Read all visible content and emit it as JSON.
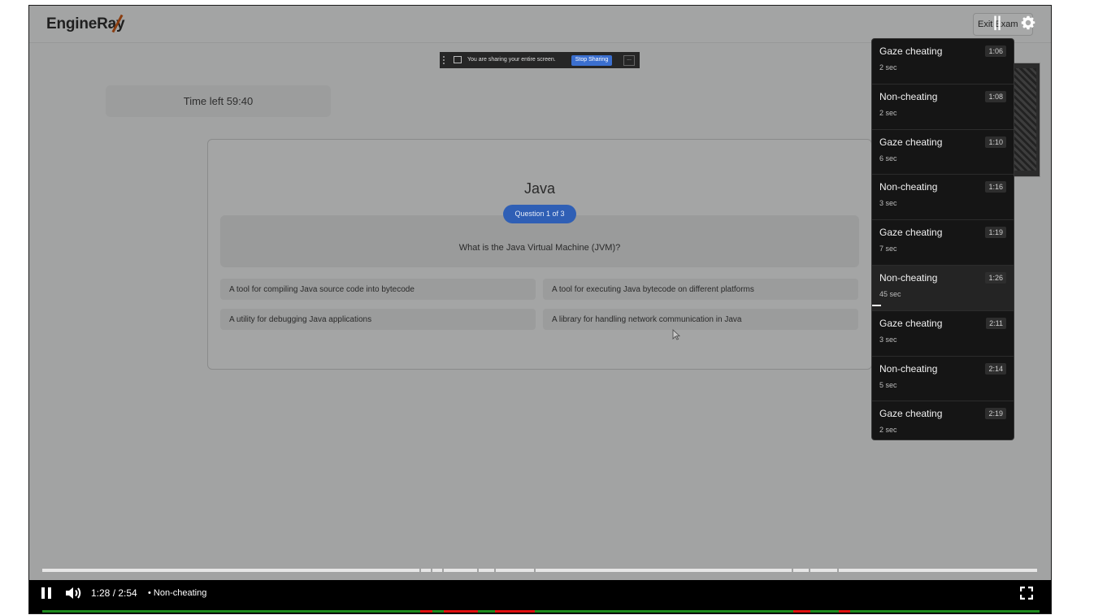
{
  "app": {
    "logo": "EngineRay",
    "exit_button": "Exit Exam",
    "timer": "Time left 59:40"
  },
  "share_bar": {
    "message": "You are sharing your entire screen.",
    "stop_button": "Stop Sharing",
    "more": "..."
  },
  "quiz": {
    "title": "Java",
    "badge": "Question 1 of 3",
    "question": "What is the Java Virtual Machine (JVM)?",
    "options": [
      "A tool for compiling Java source code into bytecode",
      "A tool for executing Java bytecode on different platforms",
      "A utility for debugging Java applications",
      "A library for handling network communication in Java"
    ]
  },
  "chapters": [
    {
      "title": "Gaze cheating",
      "time": "1:06",
      "duration": "2 sec"
    },
    {
      "title": "Non-cheating",
      "time": "1:08",
      "duration": "2 sec"
    },
    {
      "title": "Gaze cheating",
      "time": "1:10",
      "duration": "6 sec"
    },
    {
      "title": "Non-cheating",
      "time": "1:16",
      "duration": "3 sec"
    },
    {
      "title": "Gaze cheating",
      "time": "1:19",
      "duration": "7 sec"
    },
    {
      "title": "Non-cheating",
      "time": "1:26",
      "duration": "45 sec"
    },
    {
      "title": "Gaze cheating",
      "time": "2:11",
      "duration": "3 sec"
    },
    {
      "title": "Non-cheating",
      "time": "2:14",
      "duration": "5 sec"
    },
    {
      "title": "Gaze cheating",
      "time": "2:19",
      "duration": "2 sec"
    }
  ],
  "player": {
    "time": "1:28 / 2:54",
    "chapter_label": "• Non-cheating",
    "current_seconds": 88,
    "total_seconds": 174,
    "played_color": "#1d8a1d",
    "cheating_color": "#e01010"
  }
}
